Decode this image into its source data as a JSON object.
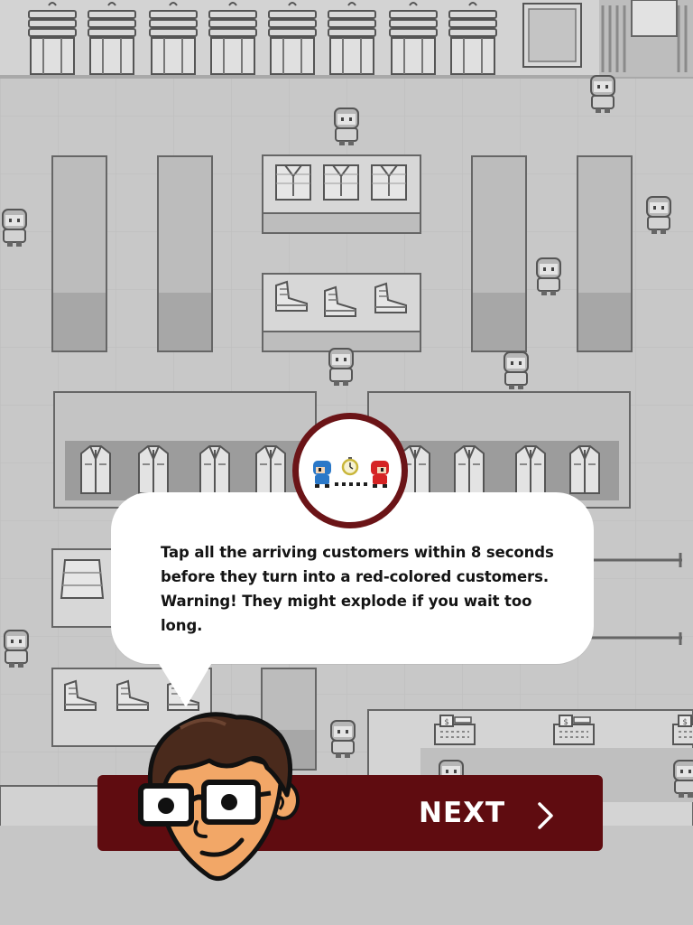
{
  "tutorial": {
    "message": "Tap all the arriving customers within 8 seconds before they turn into a red-colored customers. Warning! They might explode if you wait too long.",
    "next_label": "NEXT",
    "icons": {
      "badge": "customer-timer-icon",
      "next": "chevron-right-icon",
      "host": "host-character"
    }
  },
  "colors": {
    "background": "#c9c9c9",
    "button": "#5f0c10",
    "badge_ring": "#6b1417",
    "blue_customer": "#2a78c8",
    "red_customer": "#d52424",
    "timer": "#c9b63a"
  }
}
